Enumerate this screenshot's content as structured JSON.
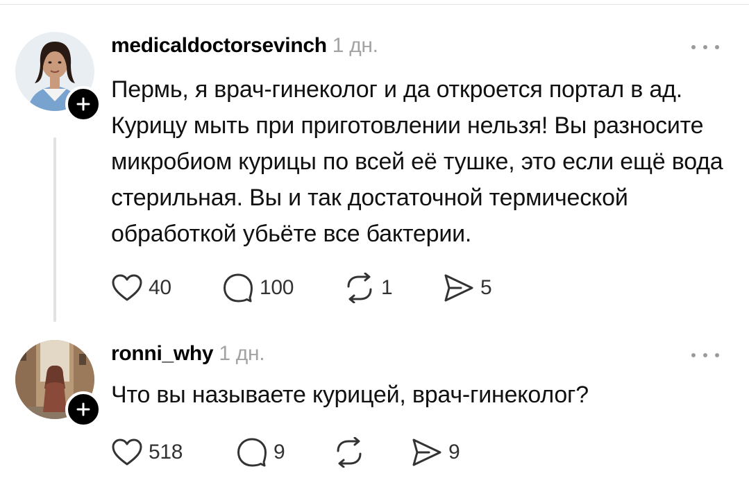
{
  "posts": [
    {
      "username": "medicaldoctorsevinch",
      "time": "1 дн.",
      "text": "Пермь, я врач-гинеколог и да откроется портал в ад. Курицу мыть при приготовлении нельзя! Вы разносите микробиом курицы по всей её тушке, это если ещё вода стерильная. Вы и так достаточной термической обработкой убьёте все бактерии.",
      "likes": "40",
      "comments": "100",
      "reposts": "1",
      "shares": "5"
    },
    {
      "username": "ronni_why",
      "time": "1 дн.",
      "text": "Что вы называете курицей, врач-гинеколог?",
      "likes": "518",
      "comments": "9",
      "reposts": "",
      "shares": "9"
    }
  ],
  "icons": {
    "like": "heart-icon",
    "comment": "comment-bubble-icon",
    "repost": "repost-arrows-icon",
    "share": "send-icon",
    "more": "more-dots-icon",
    "follow": "plus-icon"
  },
  "colors": {
    "text": "#111111",
    "muted": "#a3a3a3",
    "thread_line": "#e2e2e2"
  }
}
